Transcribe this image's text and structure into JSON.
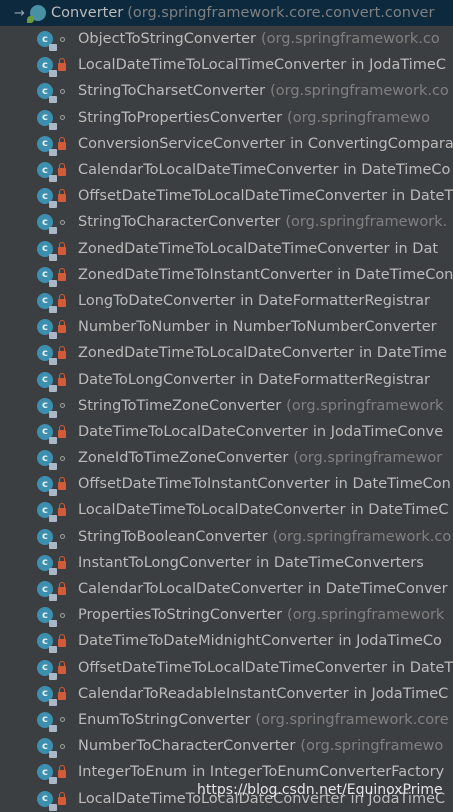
{
  "header": {
    "arrow": "→",
    "title": "Converter",
    "package": "(org.springframework.core.convert.conver"
  },
  "rows": [
    {
      "name": "ObjectToStringConverter",
      "vis": "package",
      "kind": "pkg",
      "suffix": "(org.springframework.co"
    },
    {
      "name": "LocalDateTimeToLocalTimeConverter",
      "vis": "private",
      "kind": "in",
      "suffix": "in JodaTimeC"
    },
    {
      "name": "StringToCharsetConverter",
      "vis": "package",
      "kind": "pkg",
      "suffix": "(org.springframework.co"
    },
    {
      "name": "StringToPropertiesConverter",
      "vis": "package",
      "kind": "pkg",
      "suffix": "(org.springframewo"
    },
    {
      "name": "ConversionServiceConverter",
      "vis": "private",
      "kind": "in",
      "suffix": "in ConvertingCompara"
    },
    {
      "name": "CalendarToLocalDateTimeConverter",
      "vis": "private",
      "kind": "in",
      "suffix": "in DateTimeCo"
    },
    {
      "name": "OffsetDateTimeToLocalDateTimeConverter",
      "vis": "private",
      "kind": "in",
      "suffix": "in DateTime"
    },
    {
      "name": "StringToCharacterConverter",
      "vis": "package",
      "kind": "pkg",
      "suffix": "(org.springframework."
    },
    {
      "name": "ZonedDateTimeToLocalDateTimeConverter",
      "vis": "private",
      "kind": "in",
      "suffix": "in Dat"
    },
    {
      "name": "ZonedDateTimeToInstantConverter",
      "vis": "private",
      "kind": "in",
      "suffix": "in DateTimeCon"
    },
    {
      "name": "LongToDateConverter",
      "vis": "private",
      "kind": "in",
      "suffix": "in DateFormatterRegistrar"
    },
    {
      "name": "NumberToNumber",
      "vis": "private",
      "kind": "in",
      "suffix": "in NumberToNumberConverter"
    },
    {
      "name": "ZonedDateTimeToLocalDateConverter",
      "vis": "private",
      "kind": "in",
      "suffix": "in DateTime"
    },
    {
      "name": "DateToLongConverter",
      "vis": "private",
      "kind": "in",
      "suffix": "in DateFormatterRegistrar"
    },
    {
      "name": "StringToTimeZoneConverter",
      "vis": "package",
      "kind": "pkg",
      "suffix": "(org.springframework"
    },
    {
      "name": "DateTimeToLocalDateConverter",
      "vis": "private",
      "kind": "in",
      "suffix": "in JodaTimeConve"
    },
    {
      "name": "ZoneIdToTimeZoneConverter",
      "vis": "package",
      "kind": "pkg",
      "suffix": "(org.springframewor"
    },
    {
      "name": "OffsetDateTimeToInstantConverter",
      "vis": "private",
      "kind": "in",
      "suffix": "in DateTimeCon"
    },
    {
      "name": "LocalDateTimeToLocalDateConverter",
      "vis": "private",
      "kind": "in",
      "suffix": "in DateTimeC"
    },
    {
      "name": "StringToBooleanConverter",
      "vis": "package",
      "kind": "pkg",
      "suffix": "(org.springframework.co"
    },
    {
      "name": "InstantToLongConverter",
      "vis": "private",
      "kind": "in",
      "suffix": "in DateTimeConverters"
    },
    {
      "name": "CalendarToLocalDateConverter",
      "vis": "private",
      "kind": "in",
      "suffix": "in DateTimeConver"
    },
    {
      "name": "PropertiesToStringConverter",
      "vis": "package",
      "kind": "pkg",
      "suffix": "(org.springframework"
    },
    {
      "name": "DateTimeToDateMidnightConverter",
      "vis": "private",
      "kind": "in",
      "suffix": "in JodaTimeCo"
    },
    {
      "name": "OffsetDateTimeToLocalDateTimeConverter",
      "vis": "private",
      "kind": "in",
      "suffix": "in DateT"
    },
    {
      "name": "CalendarToReadableInstantConverter",
      "vis": "private",
      "kind": "in",
      "suffix": "in JodaTimeC"
    },
    {
      "name": "EnumToStringConverter",
      "vis": "package",
      "kind": "pkg",
      "suffix": "(org.springframework.core"
    },
    {
      "name": "NumberToCharacterConverter",
      "vis": "package",
      "kind": "pkg",
      "suffix": "(org.springframewo"
    },
    {
      "name": "IntegerToEnum",
      "vis": "private",
      "kind": "in",
      "suffix": "in IntegerToEnumConverterFactory"
    },
    {
      "name": "LocalDateTimeToLocalDateConverter",
      "vis": "private",
      "kind": "in",
      "suffix": "in JodaTimeC"
    }
  ],
  "watermark": "https://blog.csdn.net/EquinoxPrime",
  "colors": {
    "background": "#3c3f41",
    "header_bg": "#0d293e",
    "text": "#bbbbbb",
    "package_text": "#808080",
    "class_icon": "#3c8fae",
    "private_lock": "#d25c3a"
  }
}
